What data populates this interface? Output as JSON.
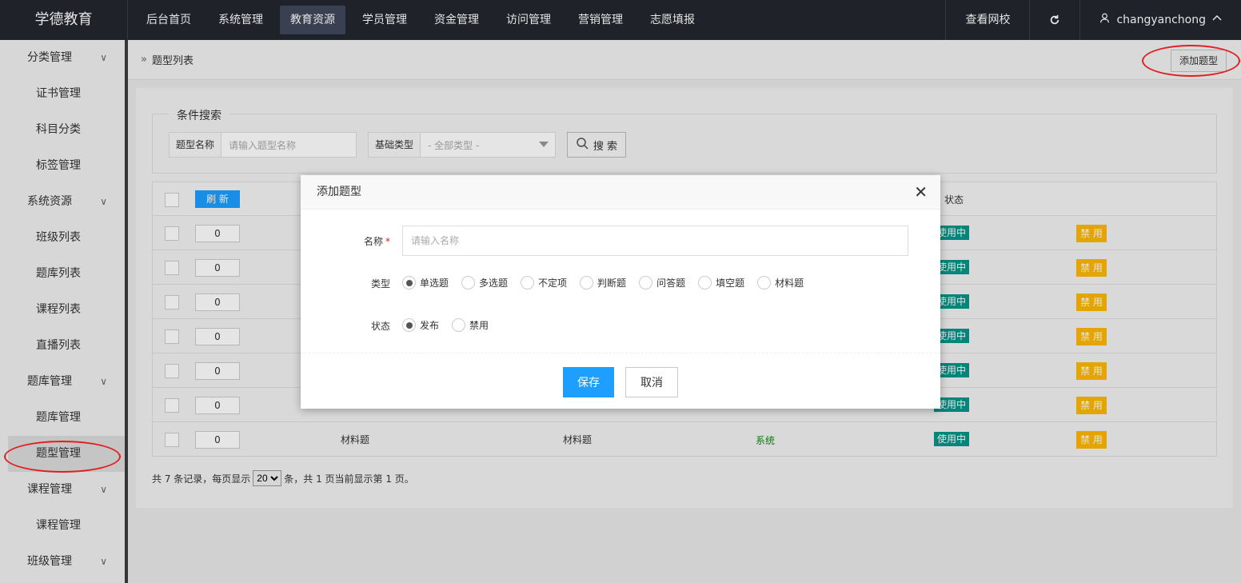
{
  "header": {
    "logo": "学德教育",
    "nav": [
      "后台首页",
      "系统管理",
      "教育资源",
      "学员管理",
      "资金管理",
      "访问管理",
      "营销管理",
      "志愿填报"
    ],
    "active_nav": "教育资源",
    "view_site": "查看网校",
    "username": "changyanchong"
  },
  "sidebar": {
    "items": [
      {
        "label": "分类管理",
        "type": "group"
      },
      {
        "label": "证书管理",
        "type": "sub"
      },
      {
        "label": "科目分类",
        "type": "sub"
      },
      {
        "label": "标签管理",
        "type": "sub"
      },
      {
        "label": "系统资源",
        "type": "group"
      },
      {
        "label": "班级列表",
        "type": "sub"
      },
      {
        "label": "题库列表",
        "type": "sub"
      },
      {
        "label": "课程列表",
        "type": "sub"
      },
      {
        "label": "直播列表",
        "type": "sub"
      },
      {
        "label": "题库管理",
        "type": "group"
      },
      {
        "label": "题库管理",
        "type": "sub"
      },
      {
        "label": "题型管理",
        "type": "sub",
        "selected": true
      },
      {
        "label": "课程管理",
        "type": "group"
      },
      {
        "label": "课程管理",
        "type": "sub"
      },
      {
        "label": "班级管理",
        "type": "group"
      }
    ]
  },
  "breadcrumb": "题型列表",
  "add_button": "添加题型",
  "search": {
    "legend": "条件搜索",
    "name_label": "题型名称",
    "name_placeholder": "请输入题型名称",
    "type_label": "基础类型",
    "type_value": "- 全部类型 -",
    "search_button": "搜 索"
  },
  "table": {
    "refresh_label": "刷 新",
    "status_header": "状态",
    "rows": [
      {
        "sort": "0",
        "tag_on": "使用中",
        "tag_off": "禁 用"
      },
      {
        "sort": "0",
        "tag_on": "使用中",
        "tag_off": "禁 用"
      },
      {
        "sort": "0",
        "tag_on": "使用中",
        "tag_off": "禁 用"
      },
      {
        "sort": "0",
        "tag_on": "使用中",
        "tag_off": "禁 用"
      },
      {
        "sort": "0",
        "tag_on": "使用中",
        "tag_off": "禁 用"
      },
      {
        "sort": "0",
        "tag_on": "使用中",
        "tag_off": "禁 用"
      },
      {
        "sort": "0",
        "name": "材料题",
        "base_type": "材料题",
        "source": "系统",
        "tag_on": "使用中",
        "tag_off": "禁 用"
      }
    ]
  },
  "pager": {
    "prefix": "共 7 条记录，每页显示",
    "page_size": "20",
    "suffix": "条，共 1 页当前显示第 1 页。"
  },
  "modal": {
    "title": "添加题型",
    "name_label": "名称",
    "name_placeholder": "请输入名称",
    "type_label": "类型",
    "type_options": [
      "单选题",
      "多选题",
      "不定项",
      "判断题",
      "问答题",
      "填空题",
      "材料题"
    ],
    "type_selected": 0,
    "status_label": "状态",
    "status_options": [
      "发布",
      "禁用"
    ],
    "status_selected": 0,
    "save": "保存",
    "cancel": "取消"
  }
}
